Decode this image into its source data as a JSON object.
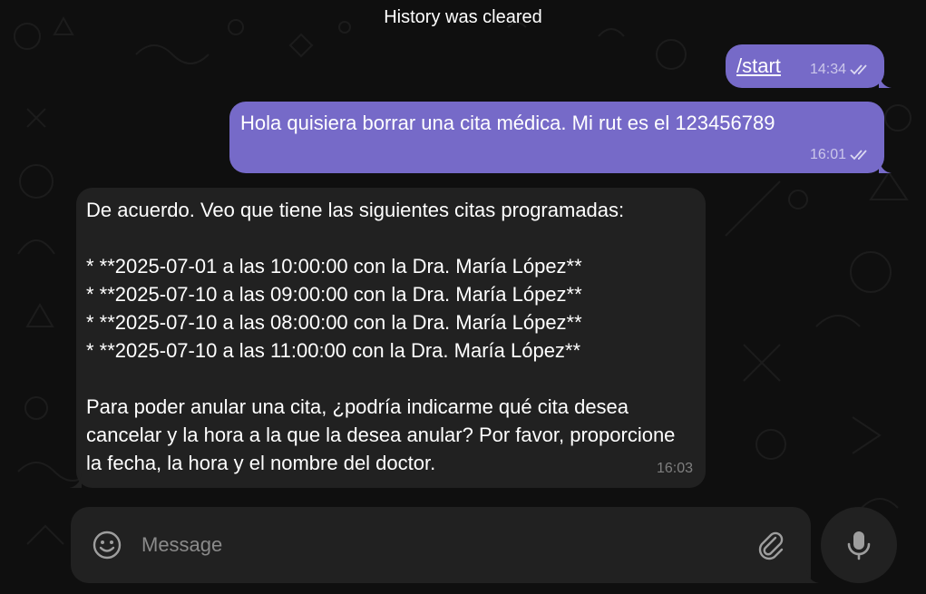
{
  "chat": {
    "service_message": "History was cleared",
    "messages": [
      {
        "direction": "out",
        "text": "/start",
        "time": "14:34",
        "status": "read"
      },
      {
        "direction": "out",
        "text": "Hola quisiera borrar una cita médica. Mi rut es el 123456789",
        "time": "16:01",
        "status": "read"
      },
      {
        "direction": "in",
        "text": "De acuerdo. Veo que tiene las siguientes citas programadas:\n\n*   **2025-07-01 a las 10:00:00 con la Dra. María López**\n*   **2025-07-10 a las 09:00:00 con la Dra. María López**\n*   **2025-07-10 a las 08:00:00 con la Dra. María López**\n*   **2025-07-10 a las 11:00:00 con la Dra. María López**\n\nPara poder anular una cita, ¿podría indicarme qué cita desea cancelar y la hora a la que la desea anular? Por favor, proporcione la fecha, la hora y el nombre del doctor.",
        "time": "16:03"
      }
    ]
  },
  "composer": {
    "placeholder": "Message",
    "value": "",
    "emoji_icon": "smile-icon",
    "attach_icon": "paperclip-icon",
    "voice_icon": "microphone-icon"
  },
  "colors": {
    "outgoing_bubble": "#766ac8",
    "incoming_bubble": "#212121",
    "background": "#0f0f0f"
  }
}
